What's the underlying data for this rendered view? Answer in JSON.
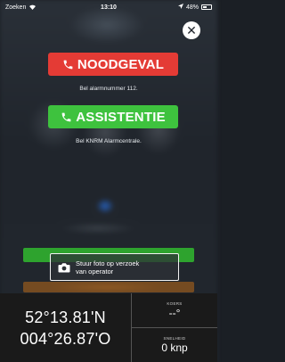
{
  "statusbar": {
    "carrier": "Zoeken",
    "time": "13:10",
    "battery": "48%",
    "icons": [
      "wifi-icon",
      "location-arrow-icon",
      "battery-icon"
    ]
  },
  "close": {
    "icon": "close-icon",
    "label": "✕"
  },
  "emergency": {
    "label": "NOODGEVAL",
    "icon": "phone-icon",
    "color": "#e43b35",
    "caption": "Bel alarmnummer 112."
  },
  "assist": {
    "label": "ASSISTENTIE",
    "icon": "phone-icon",
    "color": "#3ec23e",
    "caption": "Bel KNRM Alarmcentrale."
  },
  "photo": {
    "icon": "camera-icon",
    "line1": "Stuur foto op verzoek",
    "line2": "van operator"
  },
  "position": {
    "lat": "52°13.81'N",
    "lon": "004°26.87'O"
  },
  "course": {
    "label": "KOERS",
    "value": "--°"
  },
  "speed": {
    "label": "SNELHEID",
    "value": "0 knp"
  }
}
